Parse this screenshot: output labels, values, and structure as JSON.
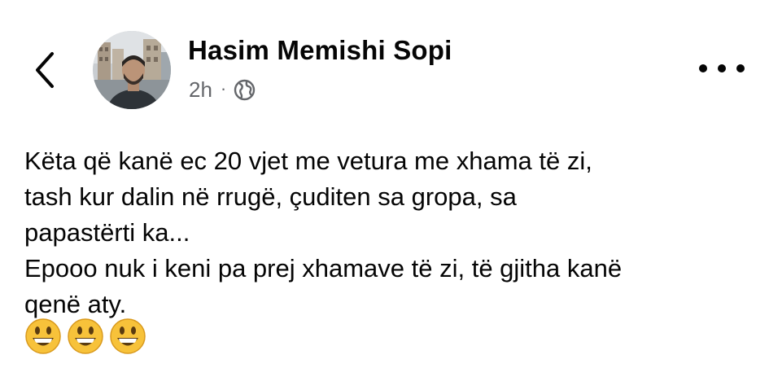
{
  "header": {
    "back_icon": "chevron-left-icon",
    "author_name": "Hasim Memishi Sopi",
    "timestamp": "2h",
    "separator": "·",
    "audience_icon": "globe-icon",
    "more_icon": "more-horizontal-icon"
  },
  "post": {
    "lines": [
      "Këta që kanë ec 20 vjet me vetura me xhama të zi,",
      "tash kur dalin në rrugë, çuditen sa gropa, sa",
      "papastërti ka...",
      "Epooo nuk i keni pa prej xhamave të zi, të gjitha kanë",
      "qenë aty."
    ],
    "emojis": [
      "😃",
      "😃",
      "😃"
    ]
  },
  "colors": {
    "text": "#050505",
    "secondary_text": "#65676b",
    "emoji_face": "#f7c23a"
  }
}
